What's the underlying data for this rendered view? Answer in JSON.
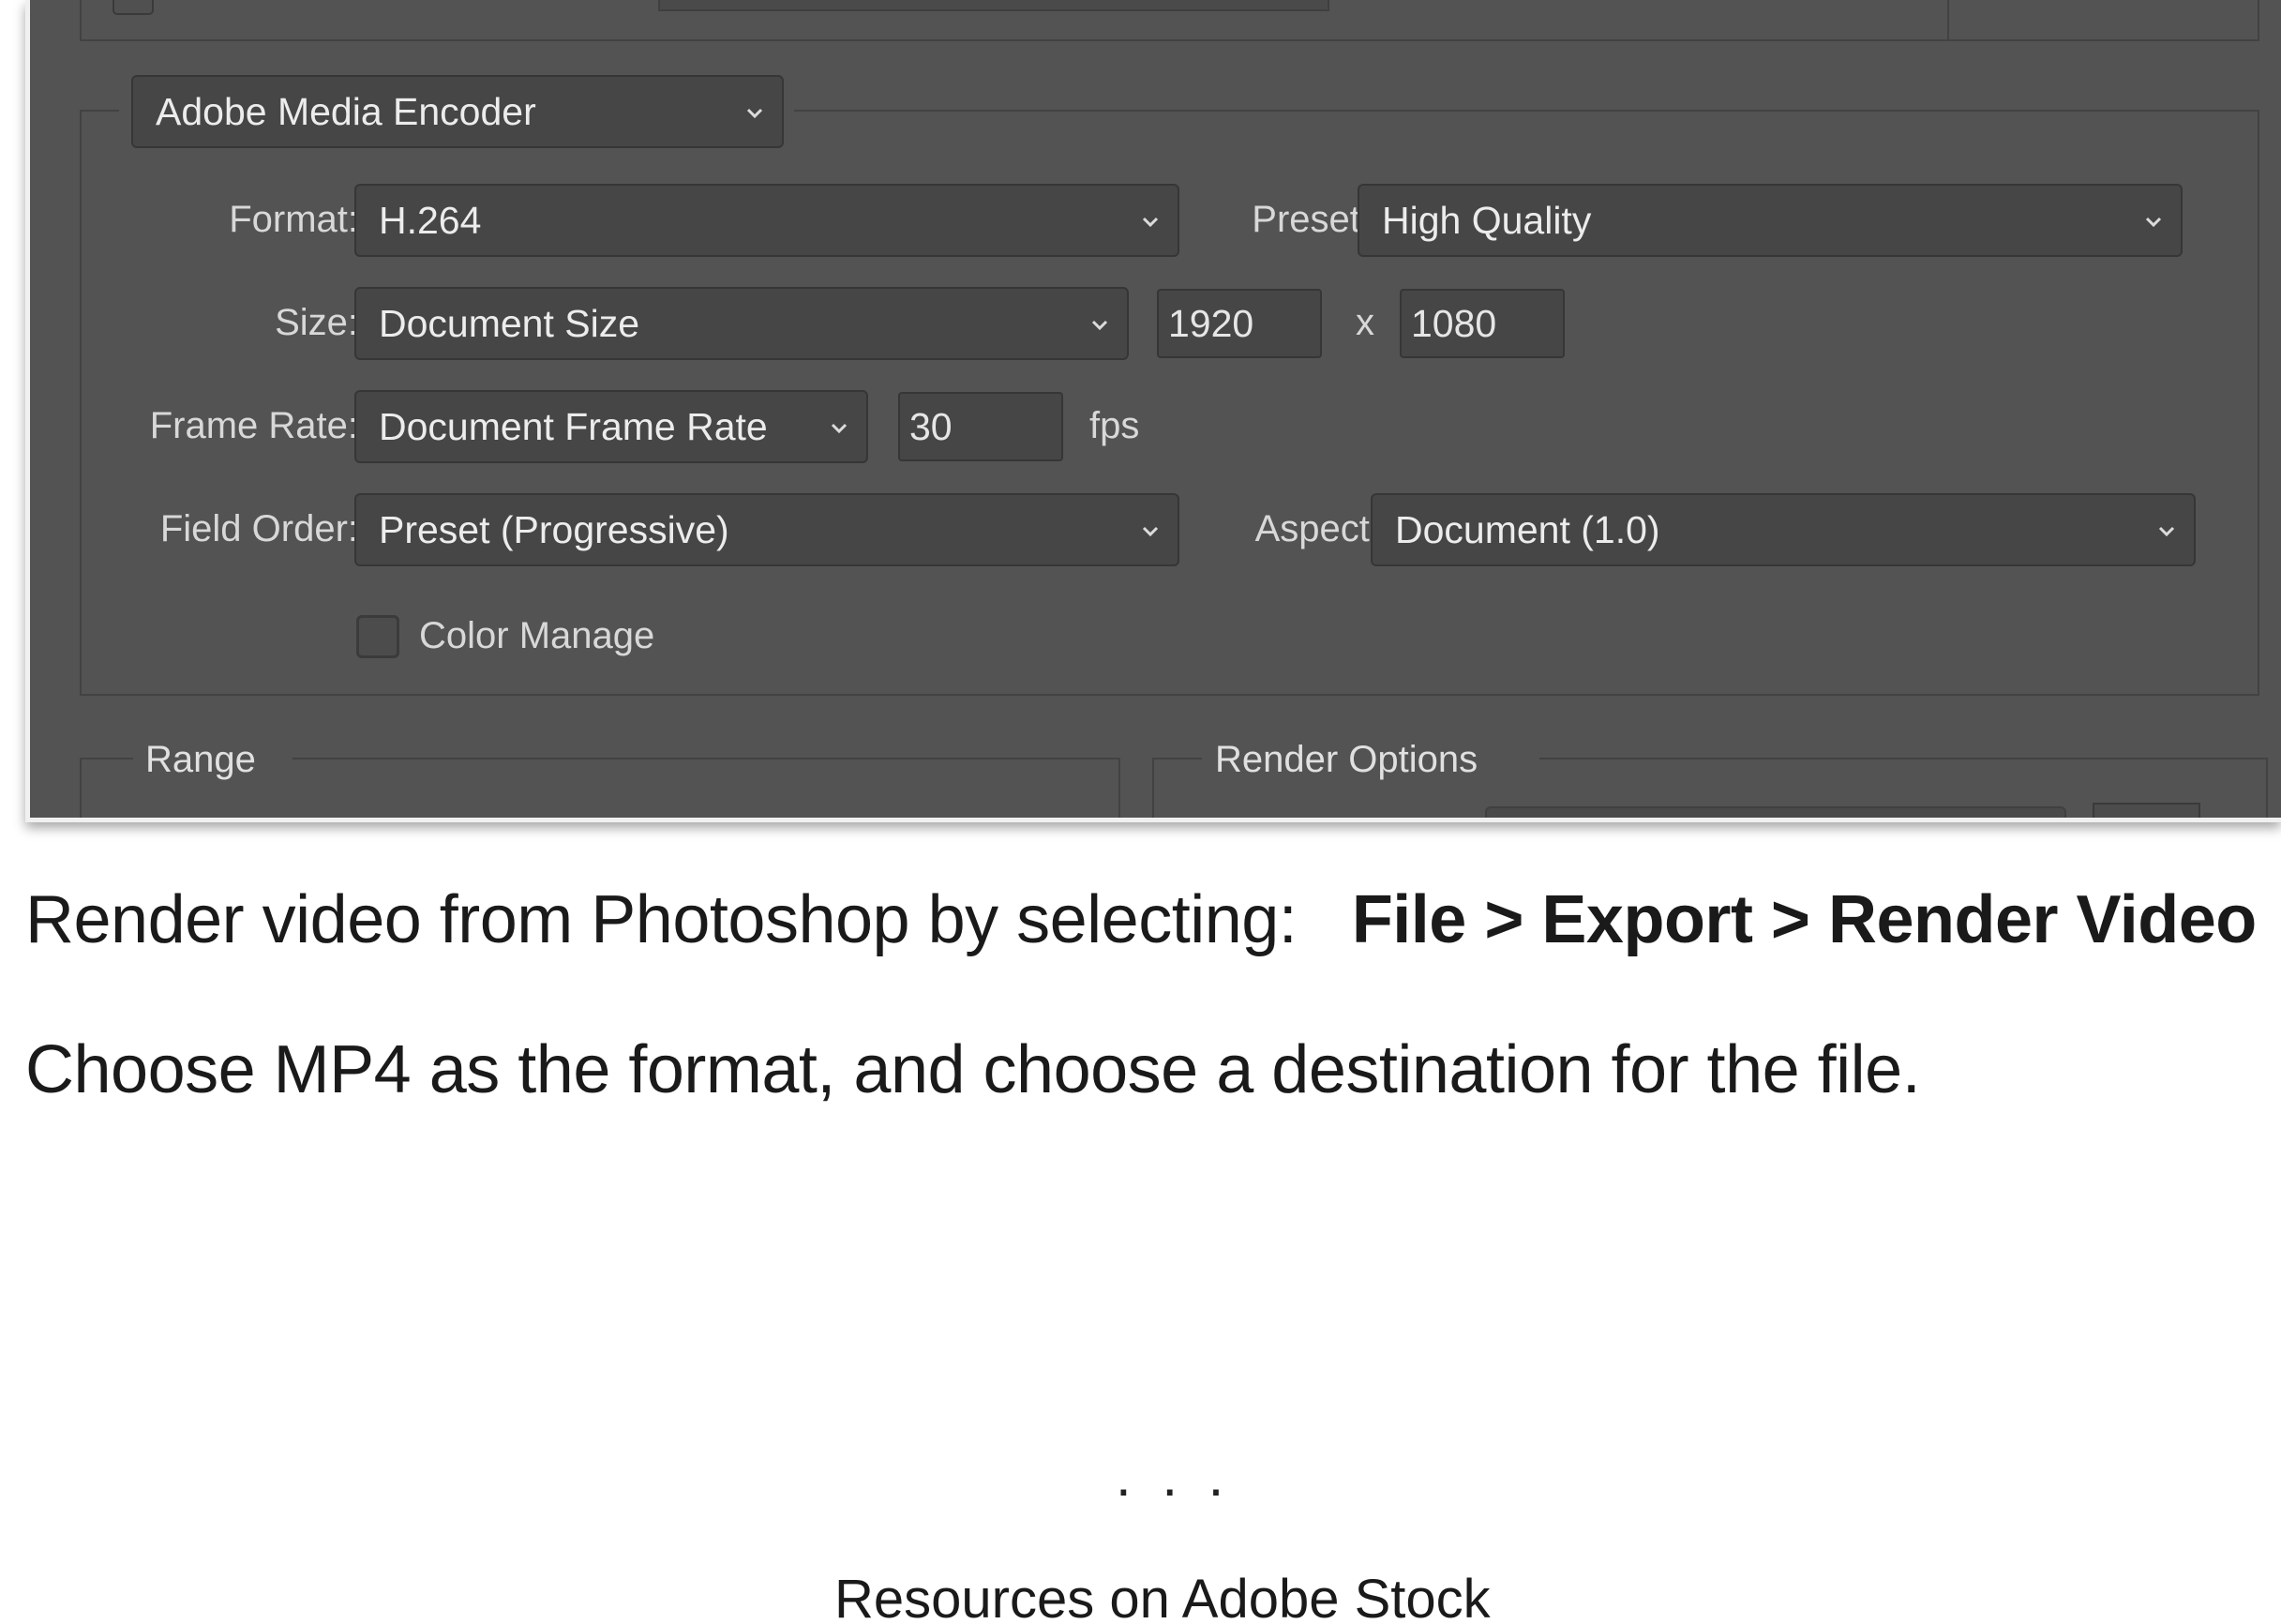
{
  "dialog": {
    "encoder_select": "Adobe Media Encoder",
    "format_label": "Format:",
    "format_value": "H.264",
    "preset_label": "Preset:",
    "preset_value": "High Quality",
    "size_label": "Size:",
    "size_value": "Document Size",
    "width_value": "1920",
    "times_symbol": "x",
    "height_value": "1080",
    "framerate_label": "Frame Rate:",
    "framerate_value": "Document Frame Rate",
    "fps_value": "30",
    "fps_unit": "fps",
    "fieldorder_label": "Field Order:",
    "fieldorder_value": "Preset (Progressive)",
    "aspect_label": "Aspect:",
    "aspect_value": "Document (1.0)",
    "color_manage_label": "Color Manage",
    "color_manage_checked": false,
    "range_title": "Range",
    "render_options_title": "Render Options"
  },
  "article": {
    "line1_prefix": "Render video from Photoshop by selecting:",
    "line1_path": "File > Export > Render Video",
    "line2": "Choose MP4 as the format, and choose a destination for the file.",
    "ellipsis": ". . .",
    "footer": "Resources on Adobe Stock"
  },
  "icons": {
    "dropdown": "chevron-down-icon",
    "checkbox": "checkbox-icon"
  }
}
